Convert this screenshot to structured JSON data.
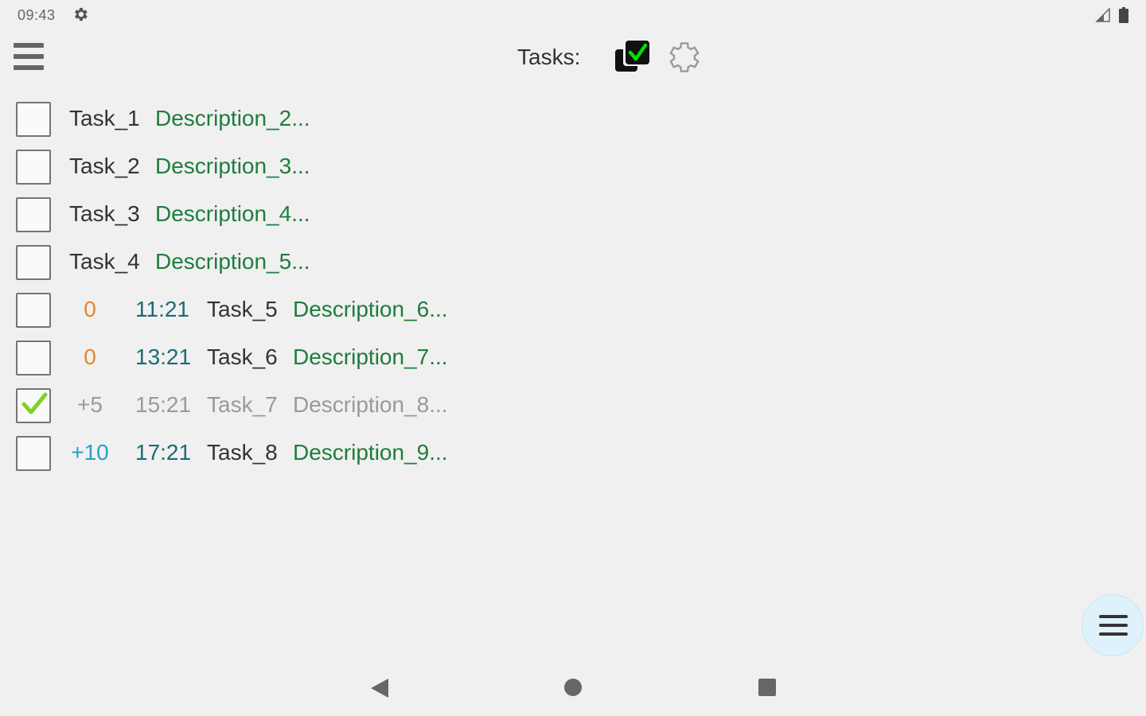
{
  "status_bar": {
    "time": "09:43",
    "icons": [
      "gear-icon",
      "signal-icon",
      "battery-icon"
    ]
  },
  "header": {
    "menu_icon": "hamburger-menu-icon",
    "title": "Tasks:",
    "actions": [
      "checked-boxes-icon",
      "settings-gear-icon"
    ]
  },
  "colors": {
    "background": "#f0f0f0",
    "task_name": "#333333",
    "description": "#1e7d3c",
    "time": "#1a6b78",
    "offset_zero": "#e8862a",
    "offset_positive": "#2a9fc4",
    "completed": "#9a9a9a",
    "check_green": "#7ed321",
    "fab_background": "#dff2fb"
  },
  "tasks": [
    {
      "checked": false,
      "offset": "",
      "time": "",
      "name": "Task_1",
      "description": "Description_2..."
    },
    {
      "checked": false,
      "offset": "",
      "time": "",
      "name": "Task_2",
      "description": "Description_3..."
    },
    {
      "checked": false,
      "offset": "",
      "time": "",
      "name": "Task_3",
      "description": "Description_4..."
    },
    {
      "checked": false,
      "offset": "",
      "time": "",
      "name": "Task_4",
      "description": "Description_5..."
    },
    {
      "checked": false,
      "offset": "0",
      "time": "11:21",
      "name": "Task_5",
      "description": "Description_6..."
    },
    {
      "checked": false,
      "offset": "0",
      "time": "13:21",
      "name": "Task_6",
      "description": "Description_7..."
    },
    {
      "checked": true,
      "offset": "+5",
      "time": "15:21",
      "name": "Task_7",
      "description": "Description_8..."
    },
    {
      "checked": false,
      "offset": "+10",
      "time": "17:21",
      "name": "Task_8",
      "description": "Description_9..."
    }
  ],
  "fab": {
    "icon": "menu-icon"
  },
  "nav_bar": {
    "icons": [
      "back-icon",
      "home-icon",
      "recents-icon"
    ]
  }
}
